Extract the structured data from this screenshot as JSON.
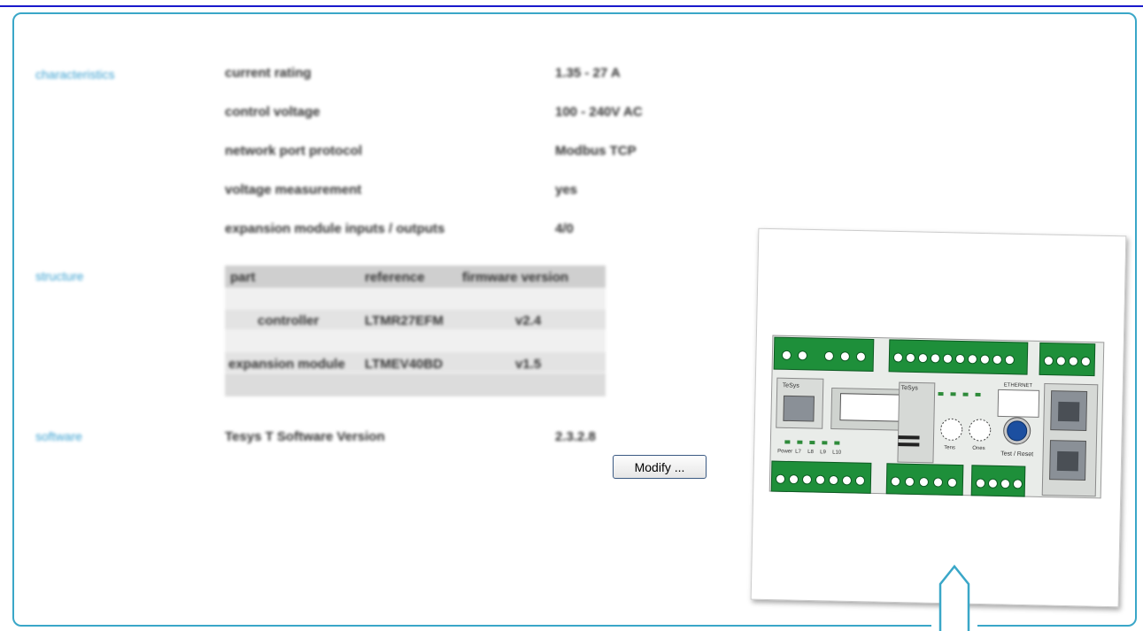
{
  "sections": {
    "characteristics": "characteristics",
    "structure": "structure",
    "software": "software"
  },
  "characteristics": [
    {
      "name": "current rating",
      "value": "1.35 - 27 A"
    },
    {
      "name": "control voltage",
      "value": "100 - 240V AC"
    },
    {
      "name": "network port protocol",
      "value": "Modbus TCP"
    },
    {
      "name": "voltage measurement",
      "value": "yes"
    },
    {
      "name": "expansion module inputs / outputs",
      "value": "4/0"
    }
  ],
  "structure": {
    "headers": [
      "part",
      "reference",
      "firmware version"
    ],
    "rows": [
      {
        "part": "controller",
        "reference": "LTMR27EFM",
        "firmware": "v2.4"
      },
      {
        "part": "expansion module",
        "reference": "LTMEV40BD",
        "firmware": "v1.5"
      }
    ]
  },
  "software": {
    "name": "Tesys T Software Version",
    "value": "2.3.2.8"
  },
  "buttons": {
    "modify": "Modify ..."
  },
  "device": {
    "brand": "TeSys",
    "brand2": "TeSys",
    "ethernet": "ETHERNET",
    "test_reset": "Test / Reset",
    "tens": "Tens",
    "ones": "Ones",
    "leds_bottom": [
      "Power",
      "L7",
      "L8",
      "L9",
      "L10"
    ]
  },
  "colors": {
    "accent": "#3aa7c8",
    "terminal_green": "#1e8f3a",
    "button_blue": "#1c4fa0"
  }
}
